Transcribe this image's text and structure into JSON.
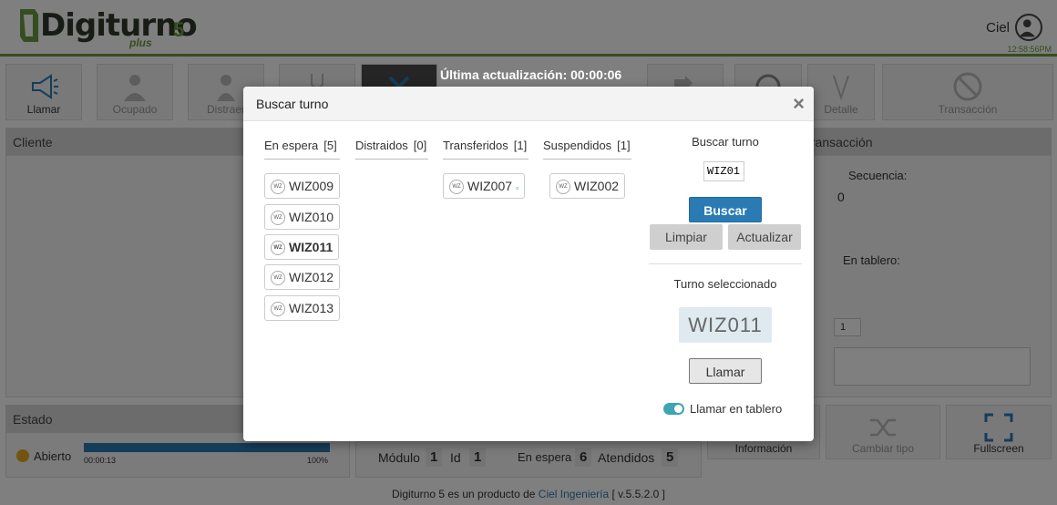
{
  "header": {
    "logo_word": "Digiturno",
    "logo_version": "5",
    "logo_edition": "plus",
    "user_name": "Ciel",
    "clock": "12:58:56PM"
  },
  "toolbar": {
    "update_banner": "Última actualización: 00:00:06",
    "buttons": [
      {
        "label": "Llamar",
        "icon": "megaphone-icon"
      },
      {
        "label": "Ocupado",
        "icon": "busy-person-icon"
      },
      {
        "label": "Distraer",
        "icon": "person-icon"
      },
      {
        "label": "",
        "icon": "fork-icon"
      },
      {
        "label": "",
        "icon": "close-icon"
      },
      {
        "label": "",
        "icon": "transfer-icon"
      },
      {
        "label": "",
        "icon": "circle-icon"
      },
      {
        "label": "Detalle",
        "icon": "detail-icon"
      },
      {
        "label": "Transacción",
        "icon": "no-transaction-icon"
      }
    ]
  },
  "panels": {
    "cliente": "Cliente",
    "transaccion": "transacción",
    "secuencia_label": "Secuencia:",
    "secuencia_value": "0",
    "en_tablero_label": "En tablero:",
    "stepper_value": "1",
    "estado": "Estado",
    "estado_value": "Abierto",
    "progress_time": "00:00:13",
    "progress_pct": "100%",
    "progress_value": 1.0,
    "modulo_label": "Módulo",
    "modulo_value": "1",
    "id_label": "Id",
    "id_value": "1",
    "en_espera_label": "En espera",
    "en_espera_value": "6",
    "atendidos_label": "Atendidos",
    "atendidos_value": "5",
    "informacion": "Información",
    "cambiar_tipo": "Cambiar tipo",
    "fullscreen": "Fullscreen"
  },
  "footer": {
    "text_before": "Digiturno 5 es un producto de",
    "link": "Ciel Ingeniería",
    "version": "[ v.5.5.2.0 ]"
  },
  "modal": {
    "title": "Buscar turno",
    "columns": [
      {
        "title": "En espera",
        "count": "[5]",
        "items": [
          "WIZ009",
          "WIZ010",
          "WIZ011",
          "WIZ012",
          "WIZ013"
        ]
      },
      {
        "title": "Distraidos",
        "count": "[0]",
        "items": []
      },
      {
        "title": "Transferidos",
        "count": "[1]",
        "items": [
          "WIZ007"
        ]
      },
      {
        "title": "Suspendidos",
        "count": "[1]",
        "items": [
          "WIZ002"
        ]
      }
    ],
    "badge_text": "WZ",
    "search_label": "Buscar turno",
    "search_value": "WIZ01:",
    "buscar_button": "Buscar",
    "limpiar_button": "Limpiar",
    "actualizar_button": "Actualizar",
    "selected_label": "Turno seleccionado",
    "selected_value": "WIZ011",
    "llamar_button": "Llamar",
    "toggle_label": "Llamar en tablero",
    "toggle_on": true
  }
}
